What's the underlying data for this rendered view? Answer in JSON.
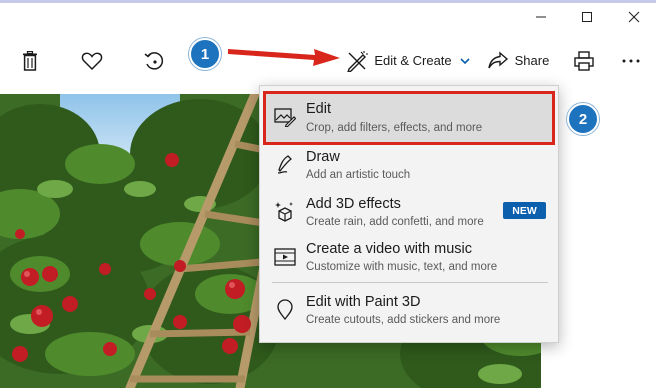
{
  "window": {
    "minimize_icon": "minimize-icon",
    "maximize_icon": "maximize-icon",
    "close_icon": "close-icon"
  },
  "toolbar": {
    "delete_icon": "trash-icon",
    "favorite_icon": "heart-icon",
    "rotate_icon": "rotate-icon",
    "edit_create_label": "Edit & Create",
    "share_label": "Share",
    "print_icon": "printer-icon",
    "more_icon": "more-icon"
  },
  "menu": {
    "items": [
      {
        "title": "Edit",
        "subtitle": "Crop, add filters, effects, and more",
        "icon": "edit-photo-icon"
      },
      {
        "title": "Draw",
        "subtitle": "Add an artistic touch",
        "icon": "pen-icon"
      },
      {
        "title": "Add 3D effects",
        "subtitle": "Create rain, add confetti, and more",
        "icon": "sparkle-3d-icon",
        "badge": "NEW"
      },
      {
        "title": "Create a video with music",
        "subtitle": "Customize with music, text, and more",
        "icon": "video-icon"
      },
      {
        "title": "Edit with Paint 3D",
        "subtitle": "Create cutouts, add stickers and more",
        "icon": "paint3d-icon"
      }
    ]
  },
  "annotations": {
    "step1": "1",
    "step2": "2",
    "accent_red": "#d9261c",
    "accent_blue": "#1e73be"
  }
}
